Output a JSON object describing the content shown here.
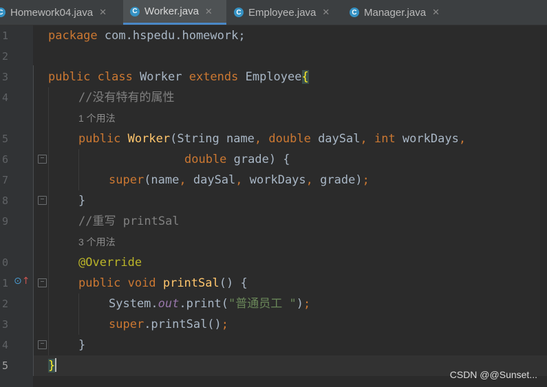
{
  "tabs": [
    {
      "label": "Homework04.java",
      "icon": "java-class-icon",
      "active": false
    },
    {
      "label": "Worker.java",
      "icon": "java-class-icon",
      "active": true
    },
    {
      "label": "Employee.java",
      "icon": "java-class-icon",
      "active": false
    },
    {
      "label": "Manager.java",
      "icon": "java-class-icon",
      "active": false
    }
  ],
  "tab_icon_letter": "C",
  "tab_close_glyph": "✕",
  "line_numbers": [
    "1",
    "2",
    "3",
    "4",
    "5",
    "6",
    "7",
    "8",
    "9",
    "0",
    "1",
    "2",
    "3",
    "4",
    "5"
  ],
  "usage_hints": {
    "constructor": "1 个用法",
    "method": "3 个用法"
  },
  "code": {
    "l1_kw": "package",
    "l1_rest": " com.hspedu.homework;",
    "l3_kw1": "public class",
    "l3_name": " Worker ",
    "l3_kw2": "extends",
    "l3_parent": " Employee",
    "l3_brace": "{",
    "l4_comment": "//没有特有的属性",
    "l5_kw1": "public",
    "l5_ctor": "Worker",
    "l5_p1": "(String name",
    "l5_c1": ",",
    "l5_kw2": " double",
    "l5_p2": " daySal",
    "l5_c2": ",",
    "l5_kw3": " int",
    "l5_p3": " workDays",
    "l5_c3": ",",
    "l6_kw": "double",
    "l6_rest": " grade) {",
    "l7_kw": "super",
    "l7_a": "(name",
    "l7_c1": ",",
    "l7_b": " daySal",
    "l7_c2": ",",
    "l7_c": " workDays",
    "l7_c3": ",",
    "l7_d": " grade)",
    "l7_semi": ";",
    "l8": "}",
    "l9_comment": "//重写 printSal",
    "l10_ann": "@Override",
    "l11_kw": "public void",
    "l11_fn": "printSal",
    "l11_rest": "() {",
    "l12_sys": "System.",
    "l12_out": "out",
    "l12_print": ".print(",
    "l12_str": "\"普通员工 \"",
    "l12_end": ")",
    "l12_semi": ";",
    "l13_kw": "super",
    "l13_rest": ".printSal()",
    "l13_semi": ";",
    "l14": "}",
    "l15_brace": "}"
  },
  "watermark": "CSDN @@Sunset...",
  "colors": {
    "background": "#2b2b2b",
    "keyword": "#cc7832",
    "function": "#ffc66d",
    "string": "#6a8759",
    "comment": "#808080",
    "annotation": "#bbb529",
    "static_field": "#9876aa"
  }
}
